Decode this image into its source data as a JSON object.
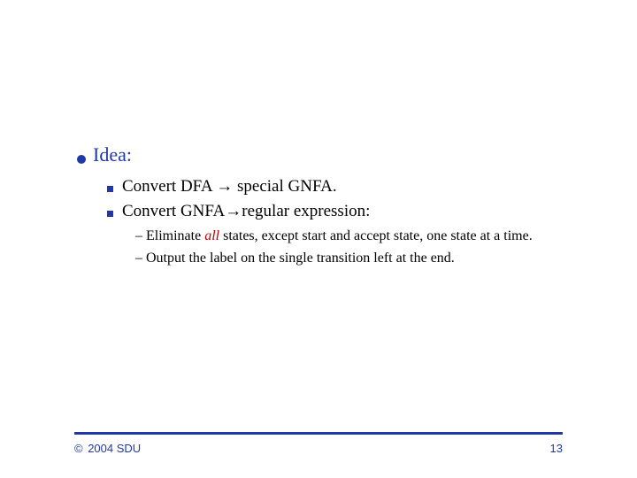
{
  "main": {
    "idea_label": "Idea:",
    "points": [
      "Convert DFA → special GNFA.",
      "Convert GNFA→regular expression:"
    ],
    "subpoints": {
      "prefix": "Eliminate ",
      "emph": "all",
      "suffix": " states, except start and accept state, one state at a time.",
      "second": "Output the label on the single transition left at the end."
    }
  },
  "footer": {
    "copyright_symbol": "©",
    "left": " 2004 SDU",
    "pagenum": "13"
  }
}
